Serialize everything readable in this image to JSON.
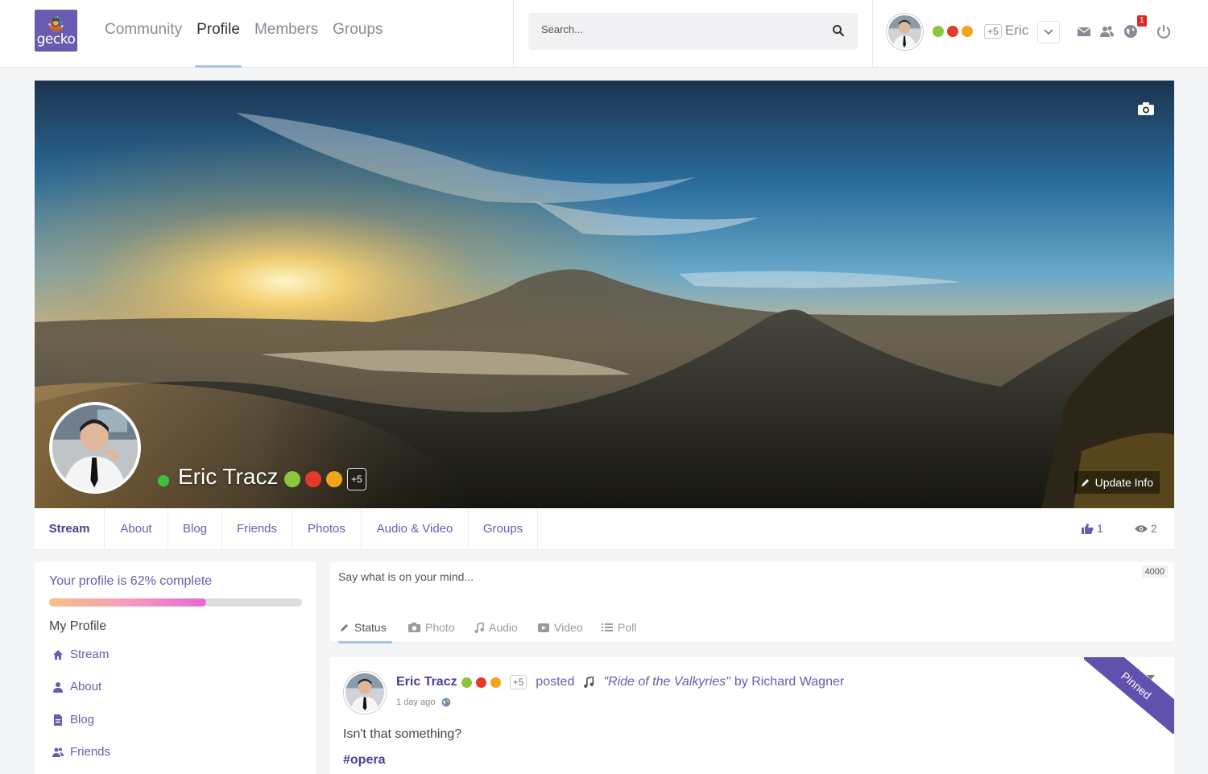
{
  "header": {
    "logo_text": "gecko",
    "nav": [
      {
        "label": "Community",
        "active": false
      },
      {
        "label": "Profile",
        "active": true
      },
      {
        "label": "Members",
        "active": false
      },
      {
        "label": "Groups",
        "active": false
      }
    ],
    "search_placeholder": "Search...",
    "user_name": "Eric",
    "badge_extra": "+5",
    "notification_count": "1",
    "icons": [
      "envelope-icon",
      "friends-icon",
      "globe-icon",
      "power-icon"
    ]
  },
  "cover": {
    "name": "Eric Tracz",
    "badge_extra": "+5",
    "update_button": "Update Info"
  },
  "tabs": {
    "items": [
      "Stream",
      "About",
      "Blog",
      "Friends",
      "Photos",
      "Audio & Video",
      "Groups"
    ],
    "active": "Stream",
    "likes": "1",
    "views": "2"
  },
  "sidebar": {
    "progress_label": "Your profile is 62% complete",
    "progress_value": 0.62,
    "section_title": "My Profile",
    "items": [
      "Stream",
      "About",
      "Blog",
      "Friends"
    ]
  },
  "composer": {
    "placeholder": "Say what is on your mind...",
    "char_limit": "4000",
    "tabs": [
      "Status",
      "Photo",
      "Audio",
      "Video",
      "Poll"
    ]
  },
  "post": {
    "author": "Eric Tracz",
    "badge_extra": "+5",
    "verb": "posted",
    "song": "\"Ride of the Valkyries\"",
    "by": "by Richard Wagner",
    "time": "1 day ago",
    "text": "Isn't that something?",
    "hashtag": "#opera",
    "pinned_label": "Pinned"
  },
  "colors": {
    "accent": "#6a5bb0",
    "accent_dark": "#4b3f98",
    "online": "#3ac43a",
    "badge_green": "#8cc63f",
    "badge_red": "#e33a2c",
    "badge_heart": "#f2a51a",
    "notif": "#e02828"
  }
}
